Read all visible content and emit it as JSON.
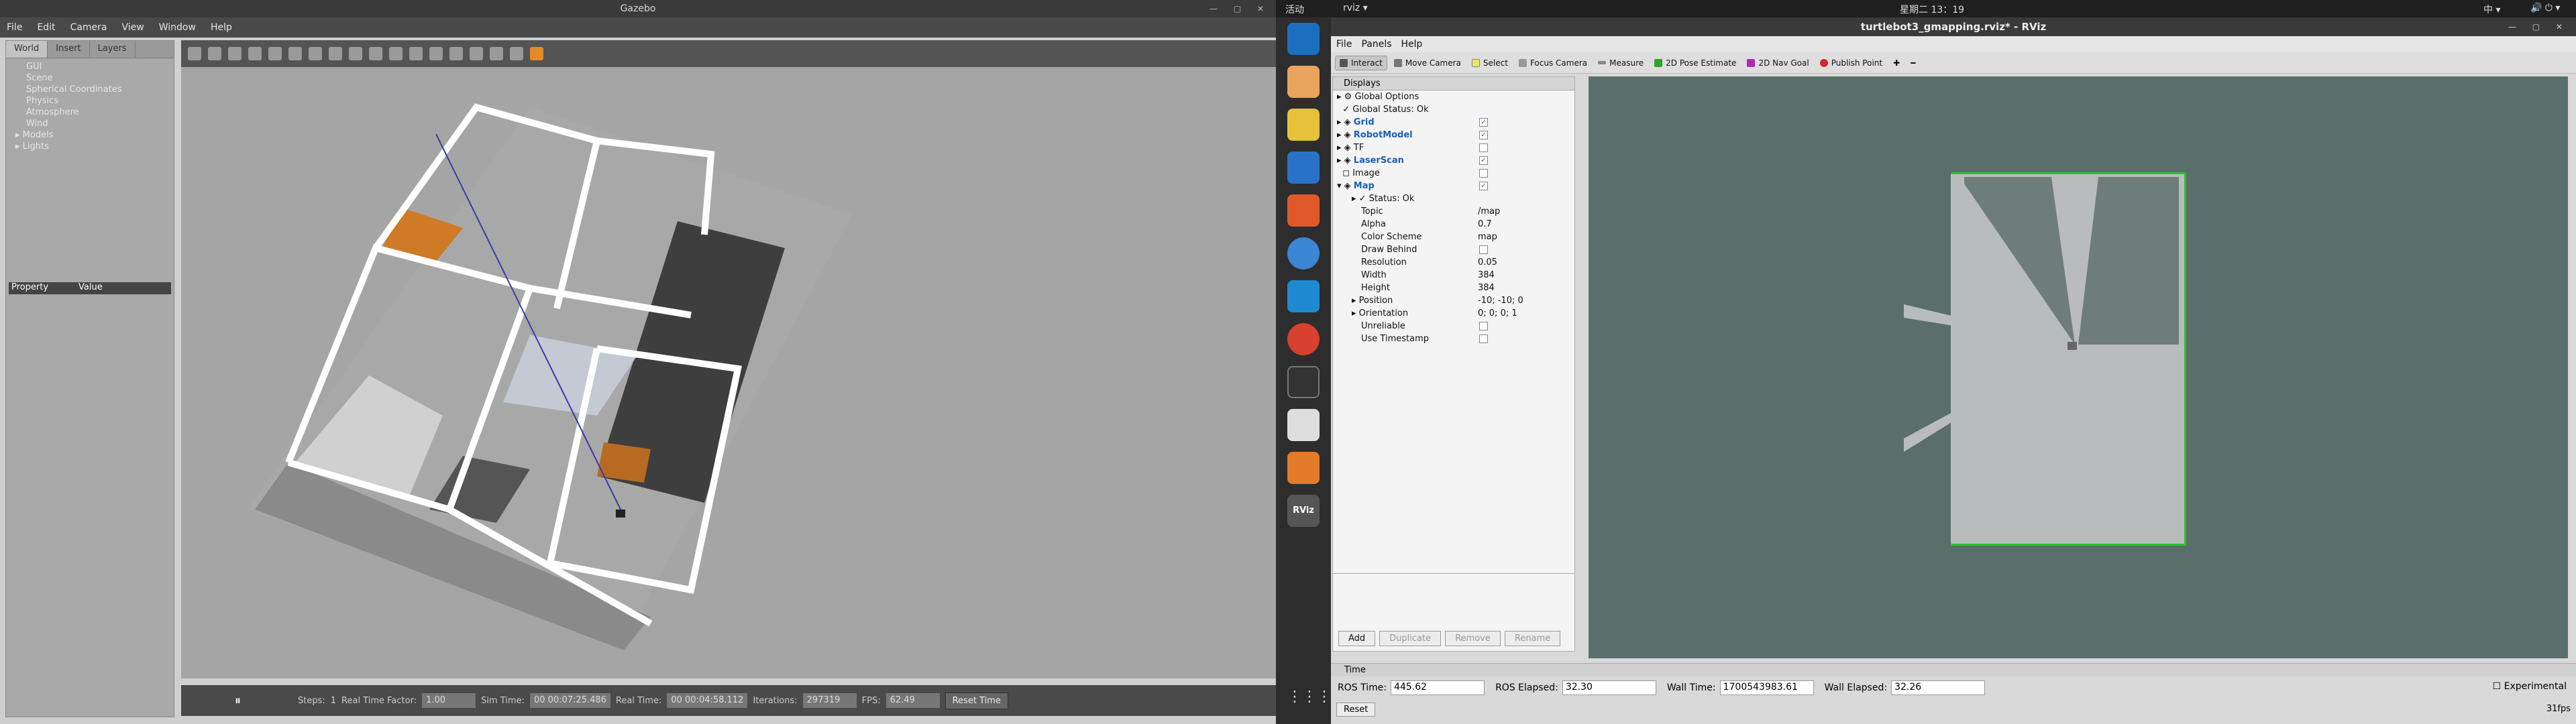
{
  "gazebo": {
    "title": "Gazebo",
    "menu": [
      "File",
      "Edit",
      "Camera",
      "View",
      "Window",
      "Help"
    ],
    "tabs": [
      "World",
      "Insert",
      "Layers"
    ],
    "tree": [
      "GUI",
      "Scene",
      "Spherical Coordinates",
      "Physics",
      "Atmosphere",
      "Wind"
    ],
    "tree_expandable": [
      "Models",
      "Lights"
    ],
    "property_header": "Property",
    "value_header": "Value",
    "bottom": {
      "steps_label": "Steps:",
      "steps_value": "1",
      "rtf_label": "Real Time Factor:",
      "rtf_value": "1.00",
      "sim_label": "Sim Time:",
      "sim_value": "00 00:07:25.486",
      "real_label": "Real Time:",
      "real_value": "00 00:04:58.112",
      "iter_label": "Iterations:",
      "iter_value": "297319",
      "fps_label": "FPS:",
      "fps_value": "62.49",
      "reset": "Reset Time"
    }
  },
  "panel": {
    "activities": "活动",
    "app_menu": "rviz ▾",
    "clock": "星期二 13：19",
    "input": "中 ▾"
  },
  "dock": [
    "thunderbird",
    "files",
    "rhythmbox",
    "writer",
    "software",
    "help",
    "vscode",
    "chrome",
    "terminal",
    "editor",
    "sublime",
    "rviz"
  ],
  "rviz": {
    "title": "turtlebot3_gmapping.rviz* - RViz",
    "menu": [
      "File",
      "Panels",
      "Help"
    ],
    "tools": [
      "Interact",
      "Move Camera",
      "Select",
      "Focus Camera",
      "Measure",
      "2D Pose Estimate",
      "2D Nav Goal",
      "Publish Point"
    ],
    "displays_title": "Displays",
    "items": [
      {
        "name": "Global Options",
        "value": ""
      },
      {
        "name": "Global Status: Ok",
        "value": ""
      },
      {
        "name": "Grid",
        "value": "✓"
      },
      {
        "name": "RobotModel",
        "value": "✓"
      },
      {
        "name": "TF",
        "value": ""
      },
      {
        "name": "LaserScan",
        "value": "✓"
      },
      {
        "name": "Image",
        "value": ""
      },
      {
        "name": "Map",
        "value": "✓"
      },
      {
        "name": "Status: Ok",
        "value": ""
      },
      {
        "name": "Topic",
        "value": "/map"
      },
      {
        "name": "Alpha",
        "value": "0.7"
      },
      {
        "name": "Color Scheme",
        "value": "map"
      },
      {
        "name": "Draw Behind",
        "value": ""
      },
      {
        "name": "Resolution",
        "value": "0.05"
      },
      {
        "name": "Width",
        "value": "384"
      },
      {
        "name": "Height",
        "value": "384"
      },
      {
        "name": "Position",
        "value": "-10; -10; 0"
      },
      {
        "name": "Orientation",
        "value": "0; 0; 0; 1"
      },
      {
        "name": "Unreliable",
        "value": ""
      },
      {
        "name": "Use Timestamp",
        "value": ""
      }
    ],
    "buttons": [
      "Add",
      "Duplicate",
      "Remove",
      "Rename"
    ],
    "time_title": "Time",
    "ros_time_label": "ROS Time:",
    "ros_time": "445.62",
    "ros_elapsed_label": "ROS Elapsed:",
    "ros_elapsed": "32.30",
    "wall_time_label": "Wall Time:",
    "wall_time": "1700543983.61",
    "wall_elapsed_label": "Wall Elapsed:",
    "wall_elapsed": "32.26",
    "experimental": "Experimental",
    "reset": "Reset",
    "fps": "31fps"
  }
}
